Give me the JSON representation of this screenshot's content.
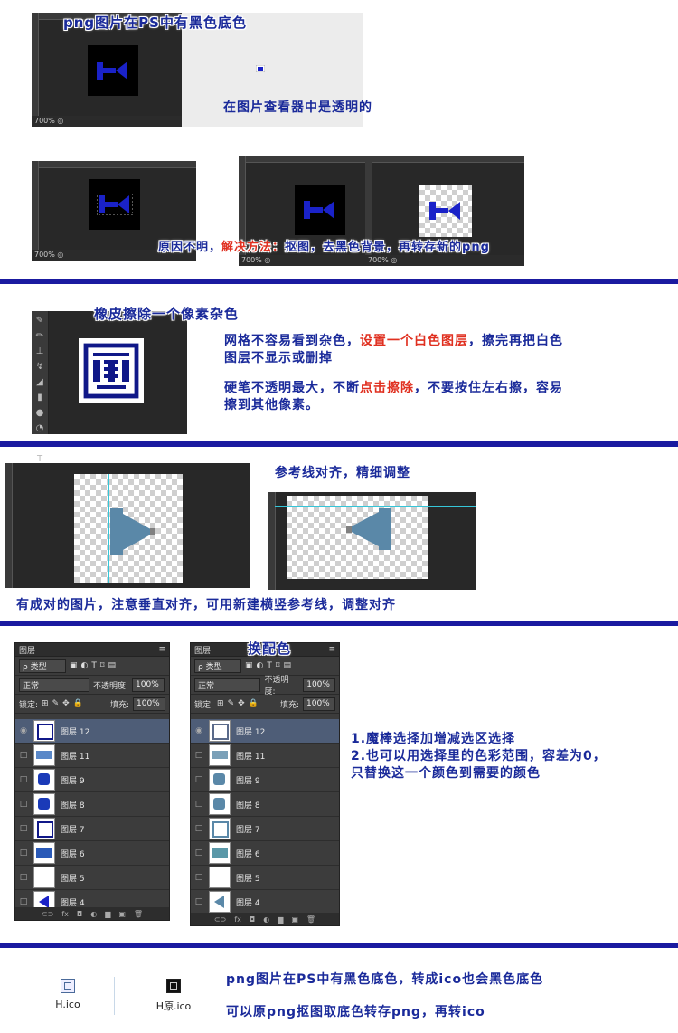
{
  "section1": {
    "title": "png图片在PS中有黑色底色",
    "viewer_note": "在图片查看器中是透明的",
    "zoom": "700%"
  },
  "section2": {
    "zoom_a": "700%",
    "zoom_b": "700%",
    "zoom_c": "700%",
    "note_prefix": "原因不明，",
    "note_red": "解决方法：",
    "note_suffix": "抠图，去黑色背景，再转存新的png"
  },
  "section3": {
    "title": "橡皮擦除一个像素杂色",
    "tip1_a": "网格不容易看到杂色，",
    "tip1_red": "设置一个白色图层",
    "tip1_b": "，擦完再把白色",
    "tip1_c": "图层不显示或删掉",
    "tip2_a": "硬笔不透明最大，不断",
    "tip2_red": "点击擦除",
    "tip2_b": "，不要按住左右擦，容易",
    "tip2_c": "擦到其他像素。"
  },
  "section4": {
    "title": "参考线对齐，精细调整",
    "note": "有成对的图片，注意垂直对齐，可用新建横竖参考线，调整对齐"
  },
  "section5": {
    "title": "换配色",
    "panel_tab": "图层",
    "filter_label": "ρ 类型",
    "blend_mode": "正常",
    "opacity_label": "不透明度:",
    "opacity_value": "100%",
    "lock_label": "锁定:",
    "fill_label": "填充:",
    "fill_value": "100%",
    "layers": [
      "图层 12",
      "图层 11",
      "图层 9",
      "图层 8",
      "图层 7",
      "图层 6",
      "图层 5",
      "图层 4"
    ],
    "tip1": "1.魔棒选择加增减选区选择",
    "tip2": "2.也可以用选择里的色彩范围，容差为0，",
    "tip3": "只替换这一个颜色到需要的颜色"
  },
  "section6": {
    "file1": "H.ico",
    "file2": "H原.ico",
    "line1": "png图片在PS中有黑色底色，转成ico也会黑色底色",
    "line2": "可以原png抠图取底色转存png，再转ico"
  },
  "colors": {
    "accent": "#1a2a9a",
    "separator": "#1a1aa0",
    "highlight": "#e03020",
    "icon_blue": "#1a22c8",
    "arrow_blue": "#5a88a8"
  }
}
